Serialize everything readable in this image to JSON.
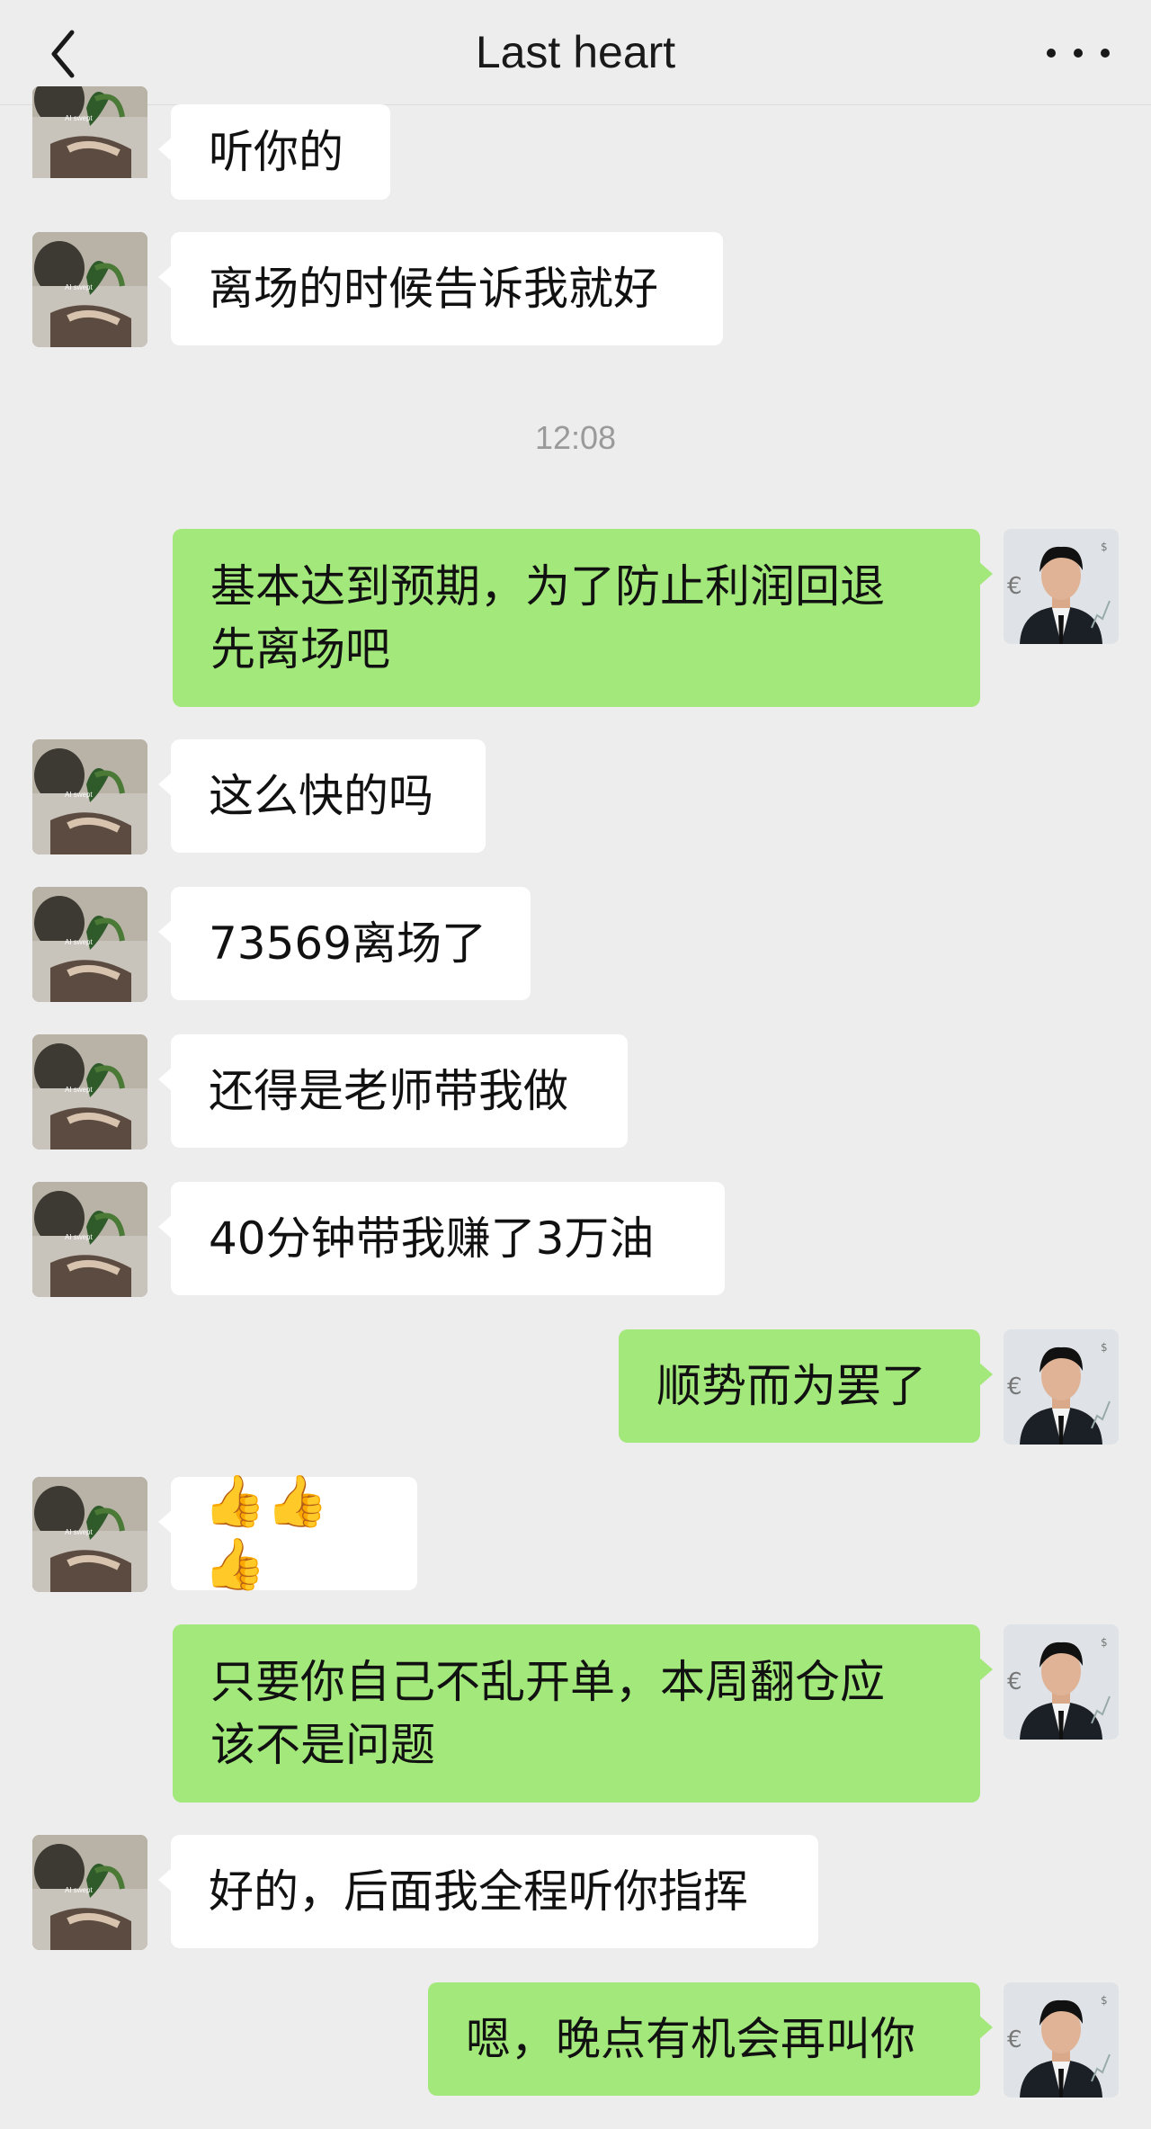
{
  "header": {
    "title": "Last heart"
  },
  "messages": [
    {
      "side": "in",
      "text": "听你的"
    },
    {
      "side": "in",
      "text": "离场的时候告诉我就好"
    },
    {
      "time": "12:08"
    },
    {
      "side": "out",
      "text": "基本达到预期，为了防止利润回退\n先离场吧"
    },
    {
      "side": "in",
      "text": "这么快的吗"
    },
    {
      "side": "in",
      "text": "73569离场了"
    },
    {
      "side": "in",
      "text": "还得是老师带我做"
    },
    {
      "side": "in",
      "text": "40分钟带我赚了3万油"
    },
    {
      "side": "out",
      "text": "顺势而为罢了"
    },
    {
      "side": "in",
      "text": "👍👍👍",
      "emoji": "thumbs-up x3"
    },
    {
      "side": "out",
      "text": "只要你自己不乱开单，本周翻仓应\n该不是问题"
    },
    {
      "side": "in",
      "text": "好的，后面我全程听你指挥"
    },
    {
      "side": "out",
      "text": "嗯，晚点有机会再叫你"
    }
  ],
  "avatars": {
    "contact": "hand-plant-photo",
    "self": "businessman-photo"
  },
  "colors": {
    "background": "#ededed",
    "incoming": "#ffffff",
    "outgoing": "#a3e87a"
  }
}
